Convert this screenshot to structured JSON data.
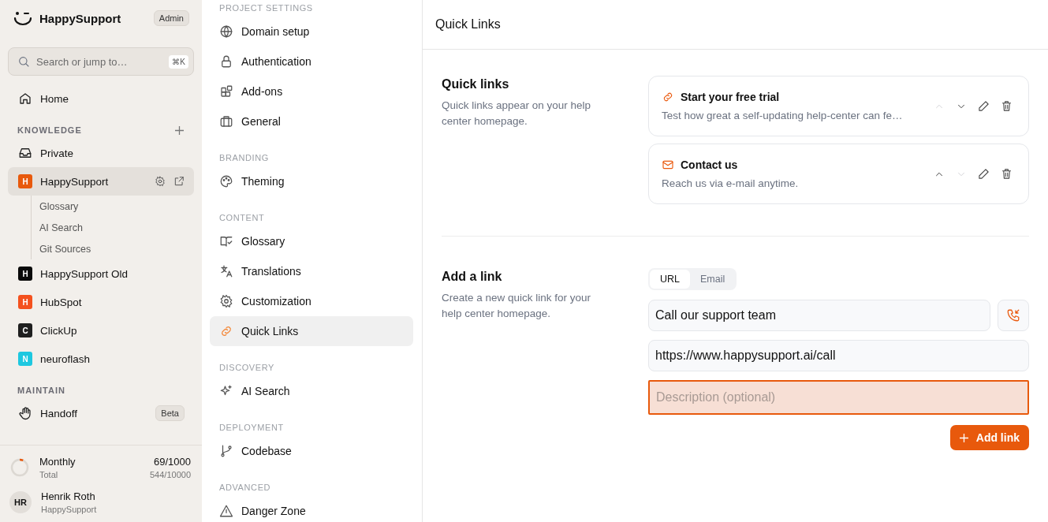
{
  "sidebar": {
    "brand": "HappySupport",
    "role_badge": "Admin",
    "search": {
      "placeholder": "Search or jump to…",
      "shortcut": "⌘K"
    },
    "home": {
      "label": "Home",
      "selected": false
    },
    "sections": [
      {
        "title": "KNOWLEDGE",
        "can_add": true,
        "items": [
          {
            "kind": "inbox",
            "label": "Private",
            "selected": false
          },
          {
            "kind": "workspace",
            "letter": "H",
            "color": "#e8590c",
            "label": "HappySupport",
            "selected": true,
            "children": [
              {
                "label": "Glossary",
                "selected": false
              },
              {
                "label": "AI Search",
                "selected": false
              },
              {
                "label": "Git Sources",
                "selected": false
              }
            ]
          },
          {
            "kind": "workspace",
            "letter": "H",
            "color": "#0a0a0a",
            "label": "HappySupport Old",
            "selected": false
          },
          {
            "kind": "workspace",
            "letter": "H",
            "color": "#f4511e",
            "label": "HubSpot",
            "selected": false
          },
          {
            "kind": "workspace",
            "letter": "C",
            "color": "#1f1f1f",
            "label": "ClickUp",
            "selected": false
          },
          {
            "kind": "workspace",
            "letter": "N",
            "color": "#1ec8e0",
            "label": "neuroflash",
            "selected": false
          }
        ]
      },
      {
        "title": "MAINTAIN",
        "can_add": false,
        "items": [
          {
            "kind": "hand",
            "label": "Handoff",
            "badge": "Beta",
            "selected": false
          }
        ]
      }
    ],
    "usage": {
      "label": "Monthly",
      "value": "69/1000",
      "sublabel": "Total",
      "subvalue": "544/10000",
      "level": 0.069
    },
    "user": {
      "initials": "HR",
      "name": "Henrik Roth",
      "org": "HappySupport"
    }
  },
  "settings_nav": [
    {
      "title": "PROJECT SETTINGS",
      "items": [
        {
          "kind": "globe",
          "label": "Domain setup",
          "selected": false
        },
        {
          "kind": "lock",
          "label": "Authentication",
          "selected": false
        },
        {
          "kind": "blocks",
          "label": "Add-ons",
          "selected": false
        },
        {
          "kind": "briefcase",
          "label": "General",
          "selected": false
        }
      ]
    },
    {
      "title": "BRANDING",
      "items": [
        {
          "kind": "palette",
          "label": "Theming",
          "selected": false
        }
      ]
    },
    {
      "title": "CONTENT",
      "items": [
        {
          "kind": "book",
          "label": "Glossary",
          "selected": false
        },
        {
          "kind": "translate",
          "label": "Translations",
          "selected": false
        },
        {
          "kind": "gear",
          "label": "Customization",
          "selected": false
        },
        {
          "kind": "link",
          "label": "Quick Links",
          "selected": true
        }
      ]
    },
    {
      "title": "DISCOVERY",
      "items": [
        {
          "kind": "sparkle",
          "label": "AI Search",
          "selected": false
        }
      ]
    },
    {
      "title": "DEPLOYMENT",
      "items": [
        {
          "kind": "branch",
          "label": "Codebase",
          "selected": false
        }
      ]
    },
    {
      "title": "ADVANCED",
      "items": [
        {
          "kind": "warning",
          "label": "Danger Zone",
          "selected": false
        }
      ]
    }
  ],
  "main": {
    "title": "Quick Links",
    "quick_links": {
      "title": "Quick links",
      "description": "Quick links appear on your help center homepage.",
      "links": [
        {
          "kind": "link",
          "title": "Start your free trial",
          "description": "Test how great a self-updating help-center can fe…",
          "up_disabled": true,
          "down_disabled": false
        },
        {
          "kind": "mail",
          "title": "Contact us",
          "description": "Reach us via e-mail anytime.",
          "up_disabled": false,
          "down_disabled": true
        }
      ]
    },
    "add_link": {
      "title": "Add a link",
      "description": "Create a new quick link for your help center homepage.",
      "tabs": [
        {
          "label": "URL",
          "selected": true
        },
        {
          "label": "Email",
          "selected": false
        }
      ],
      "name_field": {
        "value": "Call our support team"
      },
      "url_field": {
        "value": "https://www.happysupport.ai/call"
      },
      "description_field": {
        "placeholder": "Description (optional)",
        "focused": true
      },
      "button": "Add link"
    }
  }
}
